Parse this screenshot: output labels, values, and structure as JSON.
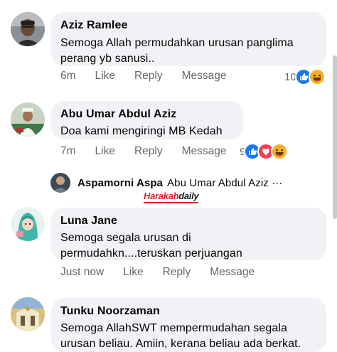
{
  "comments": [
    {
      "author": "Aziz Ramlee",
      "line1": "Semoga Allah permudahkan urusan panglima",
      "line2": "perang yb sanusi..",
      "time": "6m",
      "like": "Like",
      "reply": "Reply",
      "message": "Message",
      "reaction_count": "10",
      "reactions": [
        "like-icon",
        "haha-icon"
      ]
    },
    {
      "author": "Abu Umar Abdul Aziz",
      "line1": "Doa kami mengiringi MB Kedah",
      "time": "7m",
      "like": "Like",
      "reply": "Reply",
      "message": "Message",
      "reaction_count": "9",
      "reactions": [
        "like-icon",
        "love-icon",
        "haha-icon"
      ]
    },
    {
      "author": "Luna Jane",
      "line1": "Semoga segala urusan di",
      "line2": "permudahkn....teruskan perjuangan",
      "time": "Just now",
      "like": "Like",
      "reply": "Reply",
      "message": "Message"
    },
    {
      "author": "Tunku Noorzaman",
      "line1": "Semoga AllahSWT mempermudahan segala",
      "line2": "urusan beliau. Amiin, kerana beliau ada berkat."
    }
  ],
  "reply_preview": {
    "author": "Aspamorni Aspa",
    "text": "Abu Umar Abdul Aziz ···"
  },
  "watermark": {
    "part1": "Harakah",
    "part2": "daily"
  },
  "colors": {
    "bubble": "#f0f2f5",
    "meta_text": "#65676b",
    "like_blue": "#1877f2",
    "love_red": "#f33e58",
    "haha_yellow": "#f7b125"
  }
}
